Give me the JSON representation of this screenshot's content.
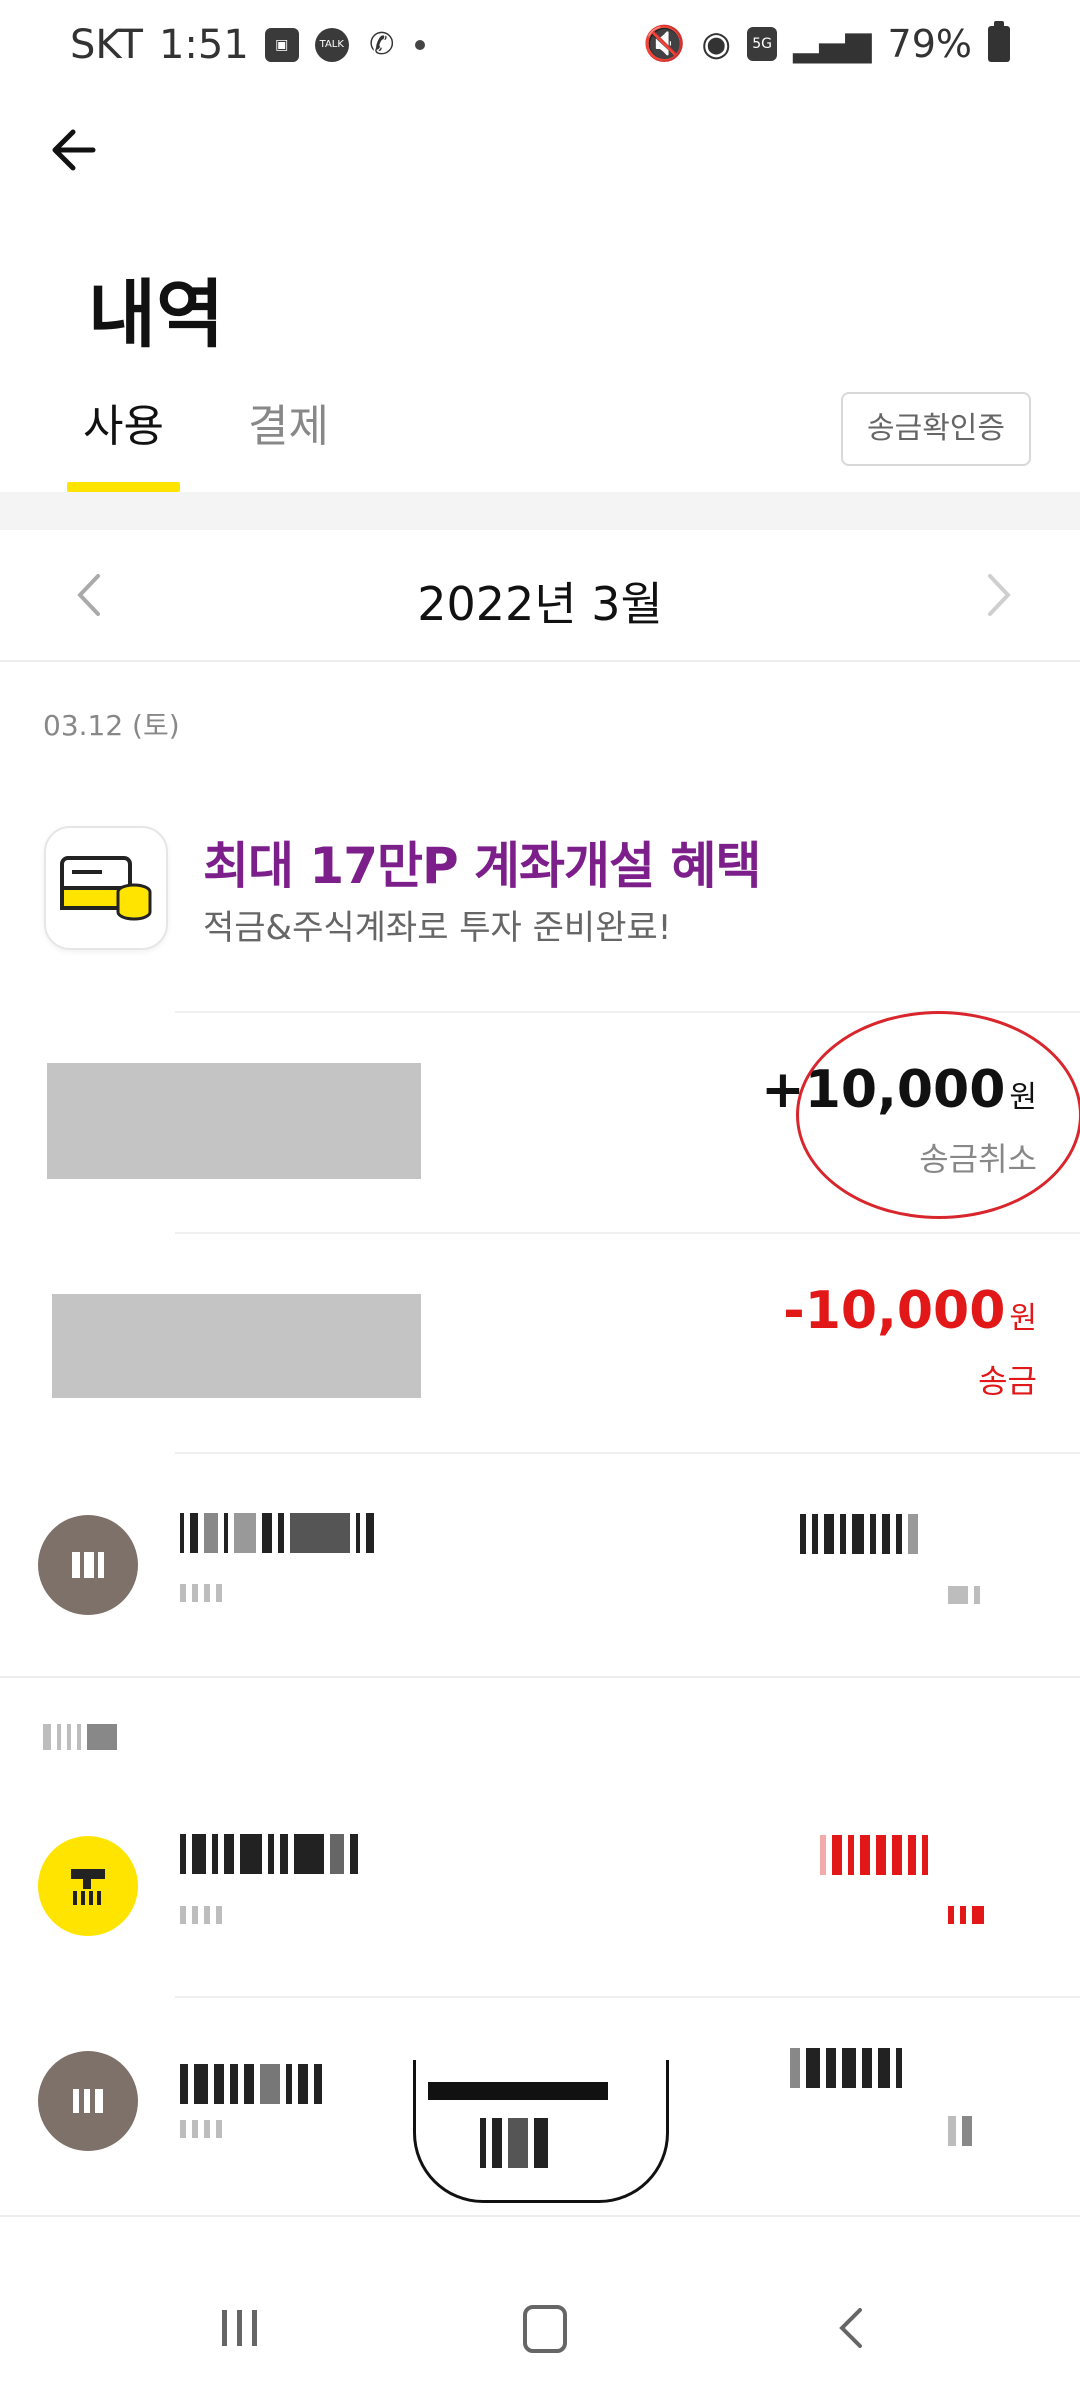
{
  "status_bar": {
    "carrier": "SKT",
    "time": "1:51",
    "notif_talk_label": "TALK",
    "network_label": "5G",
    "battery": "79%"
  },
  "header": {
    "title": "내역"
  },
  "tabs": [
    {
      "label": "사용",
      "active": true
    },
    {
      "label": "결제",
      "active": false
    }
  ],
  "remittance_confirm_label": "송금확인증",
  "month_nav": {
    "label": "2022년 3월"
  },
  "date_groups": [
    {
      "date": "03.12 (토)"
    }
  ],
  "promo": {
    "title": "최대 17만P 계좌개설 혜택",
    "subtitle": "적금&주식계좌로 투자 준비완료!"
  },
  "transactions": [
    {
      "amount": "+10,000",
      "unit": "원",
      "status": "송금취소",
      "amount_color": "#111111"
    },
    {
      "amount": "-10,000",
      "unit": "원",
      "status": "송금",
      "amount_color": "#e21818"
    }
  ],
  "colors": {
    "accent_yellow": "#ffe400",
    "negative_red": "#e21818",
    "promo_purple": "#7c1f8a",
    "annotation_red": "#d8262c"
  },
  "icons": {
    "back": "arrow-left-icon",
    "prev": "chevron-left-icon",
    "next": "chevron-right-icon",
    "nav_recent": "recent-apps-icon",
    "nav_home": "home-icon",
    "nav_back": "back-icon"
  }
}
